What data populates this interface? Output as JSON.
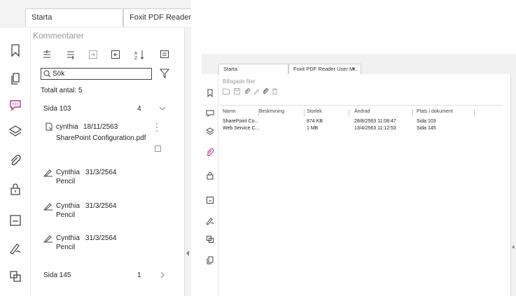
{
  "left_window": {
    "tabs": [
      {
        "label": "Starta"
      },
      {
        "label": "Foxit PDF Reader U"
      }
    ],
    "panel_title": "Kommentarer",
    "search_placeholder": "Sök",
    "total_label": "Totalt antal: 5",
    "groups": [
      {
        "page": "Sida 103",
        "count": "4"
      },
      {
        "page": "Sida 145",
        "count": "1"
      }
    ],
    "comments": [
      {
        "author": "cynthia",
        "date": "18/11/2563",
        "desc": "SharePoint Configuration.pdf"
      },
      {
        "author": "Cynthia",
        "date": "31/3/2564",
        "desc": "Pencil"
      },
      {
        "author": "Cynthia",
        "date": "31/3/2564",
        "desc": "Pencil"
      },
      {
        "author": "Cynthia",
        "date": "31/3/2564",
        "desc": "Pencil"
      }
    ]
  },
  "right_window": {
    "tabs": [
      {
        "label": "Starta"
      },
      {
        "label": "Foxit PDF Reader User M..."
      }
    ],
    "close_glyph": "×",
    "panel_title": "Bifogade filer",
    "columns": [
      "Namn",
      "Beskrivning",
      "Storlek",
      "Ändrad",
      "Plats i dokument"
    ],
    "rows": [
      {
        "name": "SharePoint Co...",
        "desc": "",
        "size": "874 KB",
        "modified": "28/8/2563 11:08:47",
        "location": "Sida 103"
      },
      {
        "name": "Web Service C...",
        "desc": "",
        "size": "1 MB",
        "modified": "13/4/2563 11:12:53",
        "location": "Sida 145"
      }
    ]
  },
  "colors": {
    "accent": "#b0368b",
    "icon": "#444444",
    "border": "#d0d0d0"
  }
}
